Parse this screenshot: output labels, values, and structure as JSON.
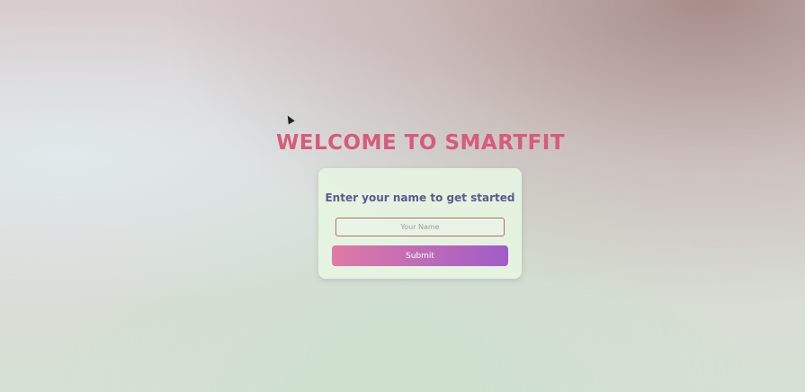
{
  "page": {
    "title": "WELCOME TO SMARTFIT"
  },
  "card": {
    "heading": "Enter your name to get started",
    "input_placeholder": "Your Name",
    "input_value": "",
    "submit_label": "Submit"
  },
  "colors": {
    "title": "#d85a7c",
    "heading": "#5b5a8e",
    "button_gradient_start": "#e07aa6",
    "button_gradient_end": "#a05cc8",
    "input_border": "#a9746c"
  },
  "icons": {
    "cursor": "mouse-pointer-icon"
  }
}
